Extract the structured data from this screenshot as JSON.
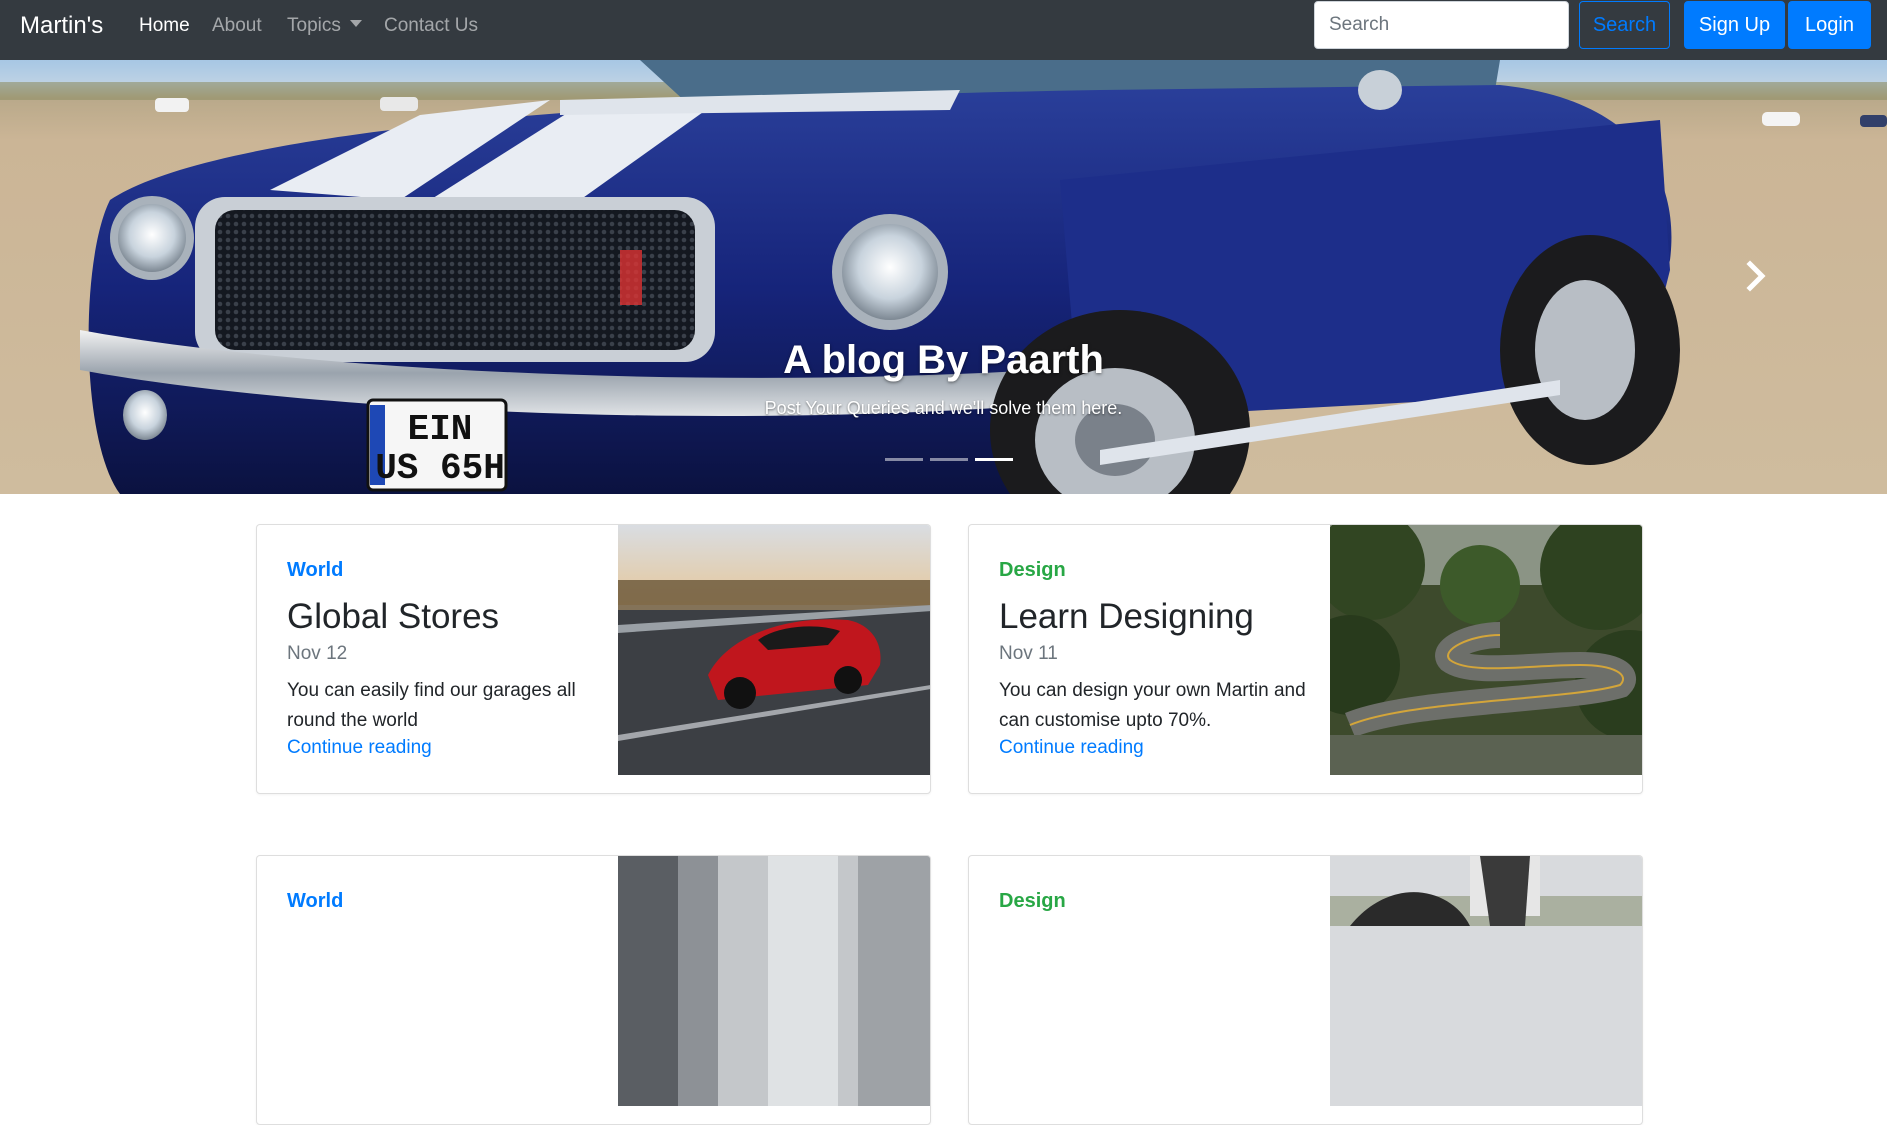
{
  "navbar": {
    "brand": "Martin's",
    "links": [
      {
        "label": "Home"
      },
      {
        "label": "About"
      },
      {
        "label": "Topics"
      },
      {
        "label": "Contact Us"
      }
    ],
    "search_placeholder": "Search",
    "search_button": "Search",
    "signup_button": "Sign Up",
    "login_button": "Login",
    "colors": {
      "background": "#343a40",
      "primary": "#007bff"
    }
  },
  "carousel": {
    "title": "A blog By Paarth",
    "subtitle": "Post Your Queries and we'll solve them here.",
    "plate_text": [
      "EIN",
      "US 65H"
    ],
    "active_slide_index": 2,
    "slide_count": 3,
    "next_icon": "chevron-right-icon"
  },
  "cards": [
    {
      "category": "World",
      "category_color": "#007bff",
      "title": "Global Stores",
      "date": "Nov 12",
      "text": "You can easily find our garages all round the world",
      "link": "Continue reading",
      "image": "red-sports-car-on-highway"
    },
    {
      "category": "Design",
      "category_color": "#28a745",
      "title": "Learn Designing",
      "date": "Nov 11",
      "text": "You can design your own Martin and can customise upto 70%.",
      "link": "Continue reading",
      "image": "winding-forest-road"
    },
    {
      "category": "World",
      "category_color": "#007bff",
      "title": "",
      "date": "",
      "text": "",
      "link": "",
      "image": "blurred-building"
    },
    {
      "category": "Design",
      "category_color": "#28a745",
      "title": "",
      "date": "",
      "text": "",
      "link": "",
      "image": "motorcycle-rider"
    }
  ]
}
